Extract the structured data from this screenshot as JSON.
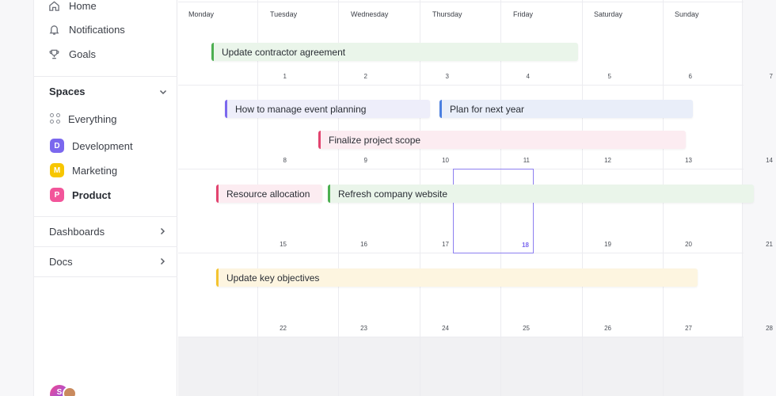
{
  "sidebar": {
    "nav": [
      {
        "label": "Home",
        "icon": "home-icon"
      },
      {
        "label": "Notifications",
        "icon": "bell-icon"
      },
      {
        "label": "Goals",
        "icon": "trophy-icon"
      }
    ],
    "spaces_heading": "Spaces",
    "everything_label": "Everything",
    "spaces": [
      {
        "letter": "D",
        "label": "Development",
        "color": "#7b68ee"
      },
      {
        "letter": "M",
        "label": "Marketing",
        "color": "#f7c600"
      },
      {
        "letter": "P",
        "label": "Product",
        "color": "#f2559a"
      }
    ],
    "dashboards_label": "Dashboards",
    "docs_label": "Docs",
    "avatar_letter": "S"
  },
  "calendar": {
    "days": [
      "Monday",
      "Tuesday",
      "Wednesday",
      "Thursday",
      "Friday",
      "Saturday",
      "Sunday"
    ],
    "weeks": [
      [
        "1",
        "2",
        "3",
        "4",
        "5",
        "6",
        "7"
      ],
      [
        "8",
        "9",
        "10",
        "11",
        "12",
        "13",
        "14"
      ],
      [
        "15",
        "16",
        "17",
        "18",
        "19",
        "20",
        "21"
      ],
      [
        "22",
        "23",
        "24",
        "25",
        "26",
        "27",
        "28"
      ]
    ],
    "today": "18",
    "events": [
      {
        "title": "Update contractor agreement",
        "color": "#4caf50"
      },
      {
        "title": "How to manage event planning",
        "color": "#7b68ee"
      },
      {
        "title": "Plan for next year",
        "color": "#4a7fe0"
      },
      {
        "title": "Finalize project scope",
        "color": "#e2446f"
      },
      {
        "title": "Resource allocation",
        "color": "#e2446f"
      },
      {
        "title": "Refresh company website",
        "color": "#4caf50"
      },
      {
        "title": "Update key objectives",
        "color": "#f4c430"
      }
    ]
  }
}
